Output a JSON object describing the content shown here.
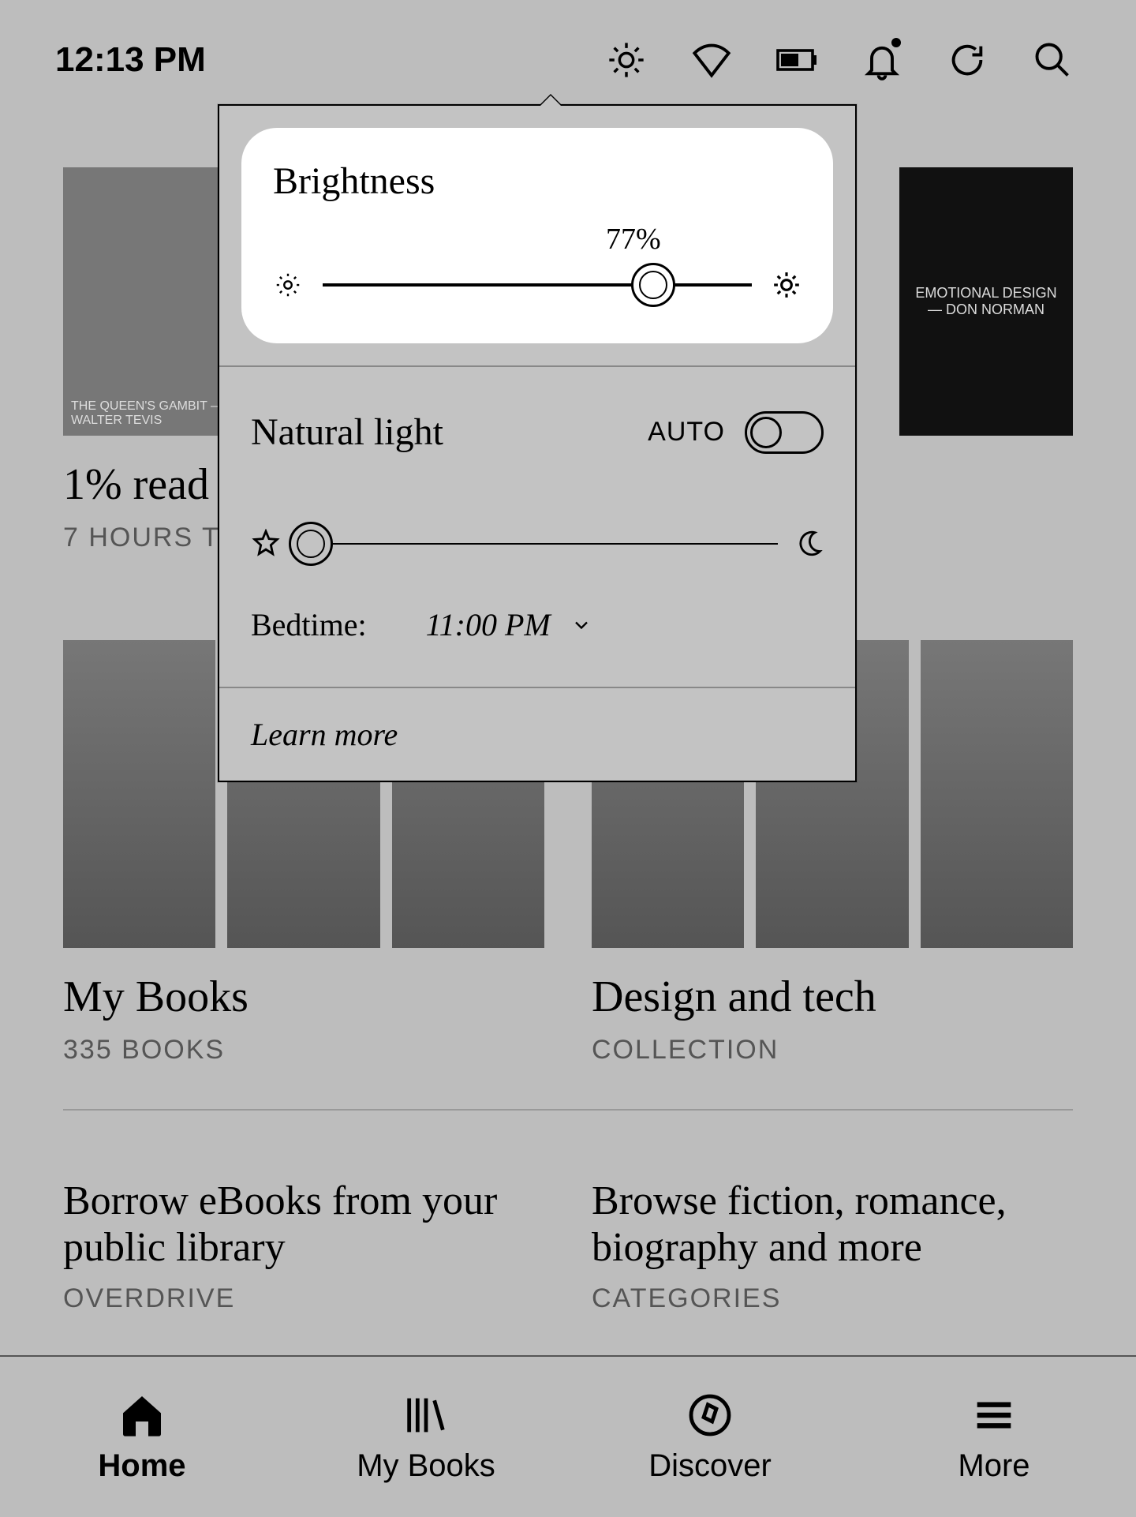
{
  "status": {
    "time": "12:13 PM"
  },
  "popup": {
    "brightness_title": "Brightness",
    "brightness_pct": "77%",
    "brightness_value": 77,
    "natural_title": "Natural light",
    "auto_label": "AUTO",
    "auto_on": false,
    "natural_value": 3,
    "bedtime_label": "Bedtime:",
    "bedtime_value": "11:00 PM",
    "learn_more": "Learn more"
  },
  "reading": {
    "progress": "1% read",
    "remaining": "7 HOURS TO GO",
    "cover_left": "THE QUEEN'S GAMBIT — WALTER TEVIS",
    "cover_right": "EMOTIONAL DESIGN — DON NORMAN"
  },
  "sections": {
    "mybooks": {
      "title": "My Books",
      "subtitle": "335 BOOKS"
    },
    "design": {
      "title": "Design and tech",
      "subtitle": "COLLECTION"
    },
    "borrow": {
      "title": "Borrow eBooks from your public library",
      "subtitle": "OVERDRIVE"
    },
    "browse": {
      "title": "Browse fiction, romance, biography and more",
      "subtitle": "CATEGORIES"
    }
  },
  "nav": {
    "home": "Home",
    "mybooks": "My Books",
    "discover": "Discover",
    "more": "More"
  }
}
